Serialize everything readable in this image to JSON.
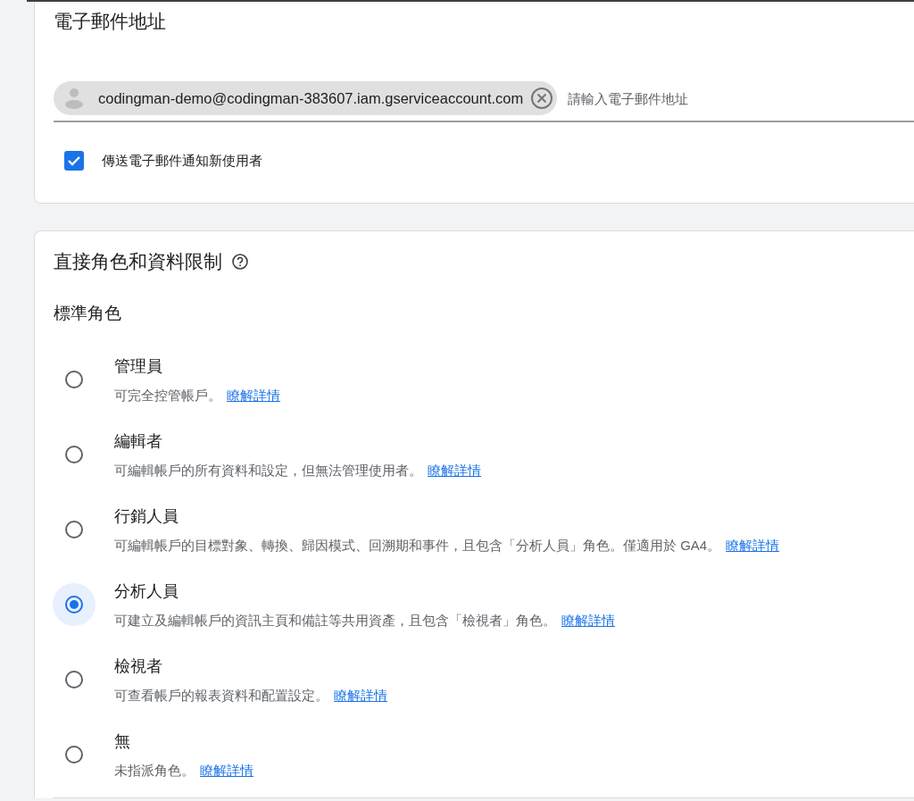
{
  "email_section": {
    "title": "電子郵件地址",
    "recipient_chip": "codingman-demo@codingman-383607.iam.gserviceaccount.com",
    "input": {
      "placeholder": "請輸入電子郵件地址"
    },
    "notify_checkbox": {
      "label": "傳送電子郵件通知新使用者",
      "checked": true
    }
  },
  "roles_section": {
    "title": "直接角色和資料限制",
    "subtitle": "標準角色",
    "roles": [
      {
        "name": "管理員",
        "description": "可完全控管帳戶。",
        "link": "瞭解詳情",
        "selected": false
      },
      {
        "name": "編輯者",
        "description": "可編輯帳戶的所有資料和設定，但無法管理使用者。",
        "link": "瞭解詳情",
        "selected": false
      },
      {
        "name": "行銷人員",
        "description": "可編輯帳戶的目標對象、轉換、歸因模式、回溯期和事件，且包含「分析人員」角色。僅適用於 GA4。",
        "link": "瞭解詳情",
        "selected": false
      },
      {
        "name": "分析人員",
        "description": "可建立及編輯帳戶的資訊主頁和備註等共用資產，且包含「檢視者」角色。",
        "link": "瞭解詳情",
        "selected": true
      },
      {
        "name": "檢視者",
        "description": "可查看帳戶的報表資料和配置設定。",
        "link": "瞭解詳情",
        "selected": false
      },
      {
        "name": "無",
        "description": "未指派角色。",
        "link": "瞭解詳情",
        "selected": false
      }
    ]
  }
}
